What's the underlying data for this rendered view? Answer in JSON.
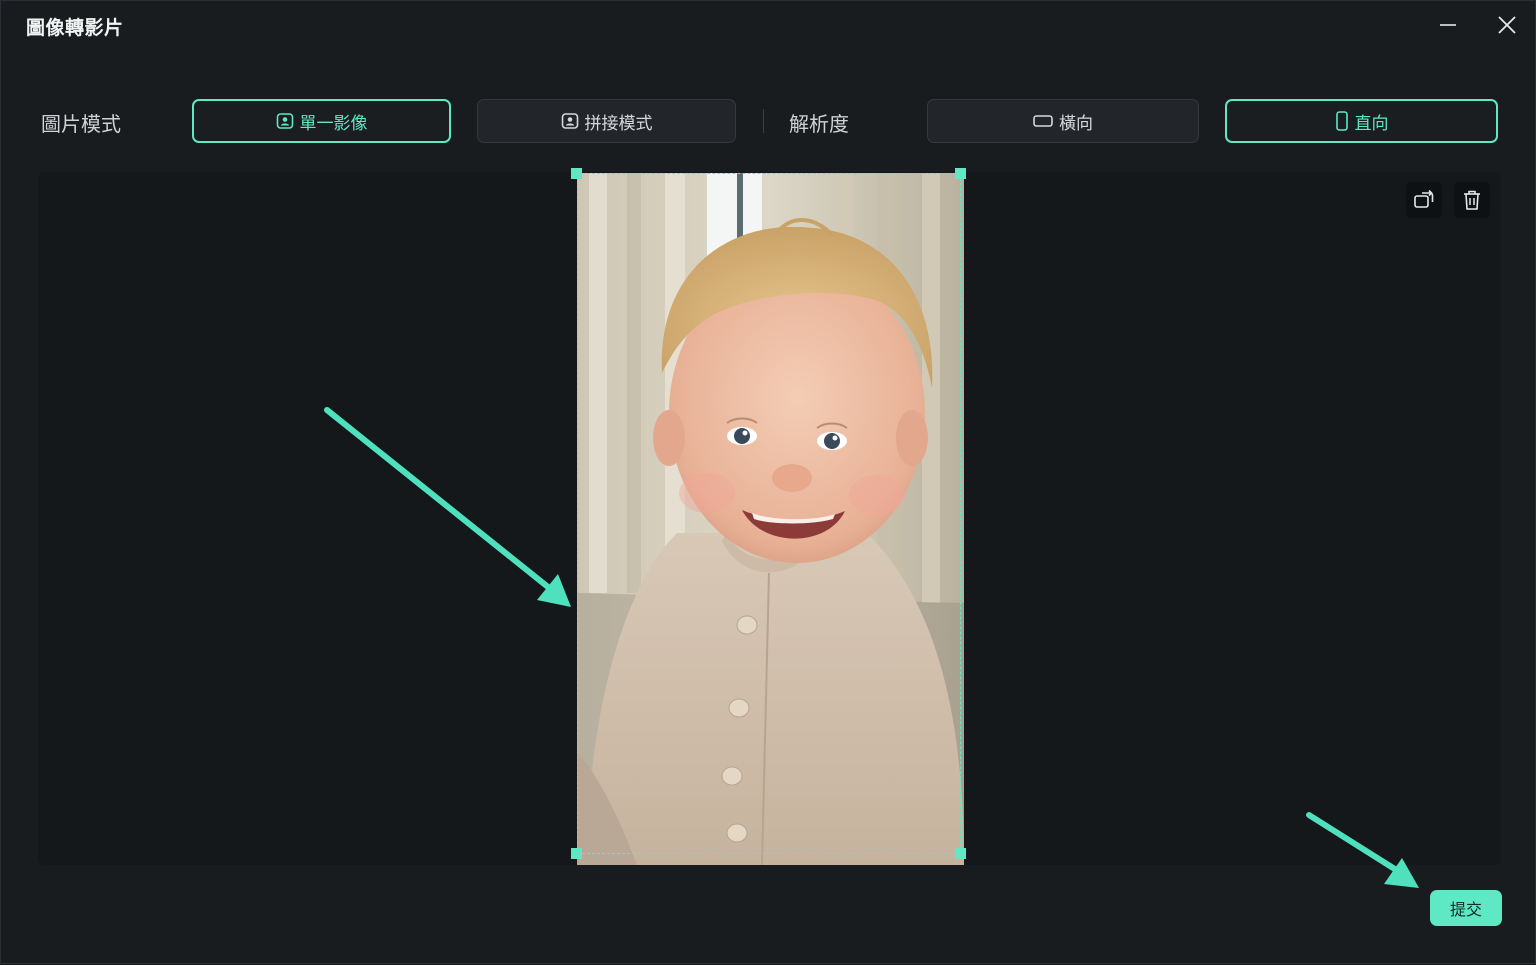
{
  "window": {
    "title": "圖像轉影片",
    "minimize_icon": "minimize-icon",
    "close_icon": "close-icon"
  },
  "toolbar": {
    "mode_label": "圖片模式",
    "mode_options": [
      {
        "label": "單一影像",
        "icon": "portrait-frame-icon",
        "selected": true
      },
      {
        "label": "拼接模式",
        "icon": "portrait-frame-icon",
        "selected": false
      }
    ],
    "resolution_label": "解析度",
    "resolution_options": [
      {
        "label": "橫向",
        "icon": "landscape-icon",
        "selected": false
      },
      {
        "label": "直向",
        "icon": "portrait-icon",
        "selected": true
      }
    ]
  },
  "canvas": {
    "tools": [
      {
        "name": "replace-image",
        "icon": "replace-image-icon"
      },
      {
        "name": "delete",
        "icon": "trash-icon"
      }
    ],
    "image": {
      "subject": "smiling baby in beige cardigan"
    }
  },
  "footer": {
    "submit_label": "提交"
  },
  "colors": {
    "accent": "#5ee8c4",
    "background": "#191c1f",
    "canvas": "#14181b",
    "button": "#22262a"
  }
}
